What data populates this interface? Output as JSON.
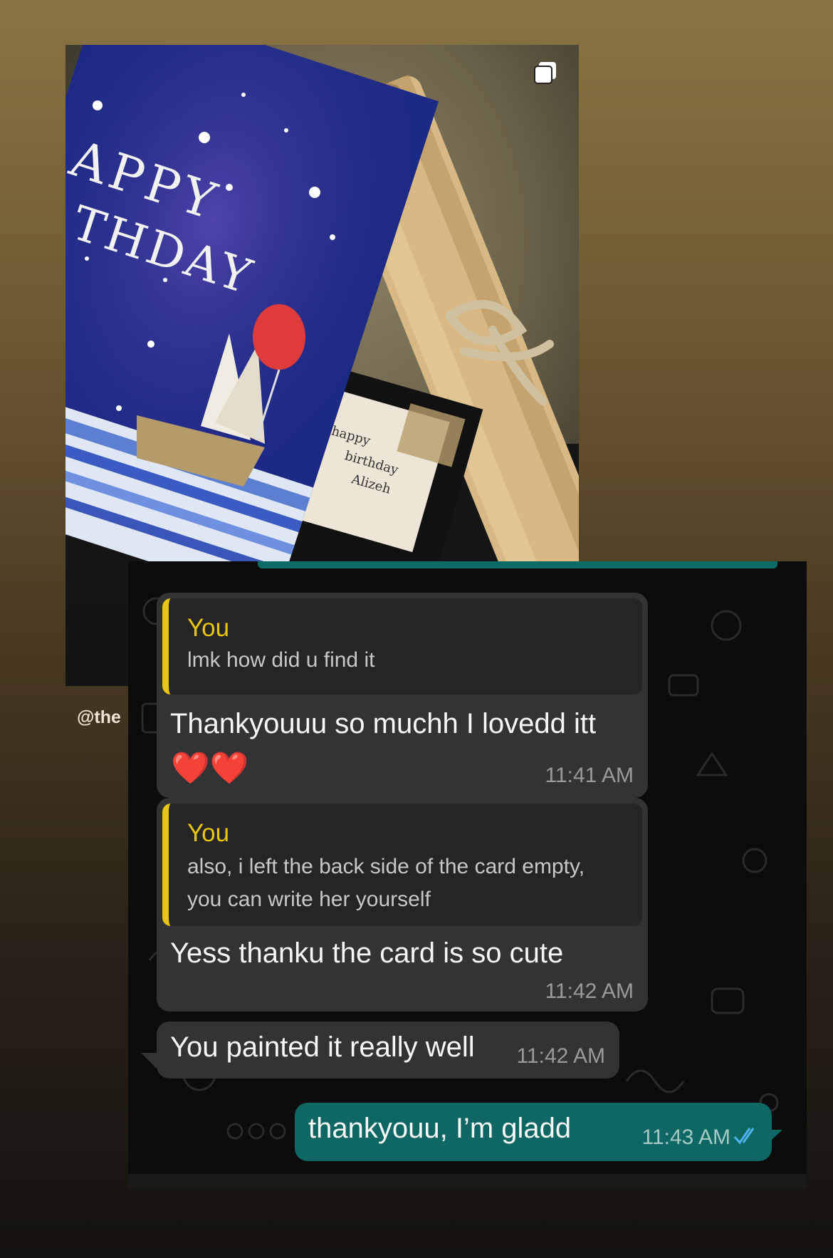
{
  "post": {
    "handle": "@the",
    "photo_icon": "multiple-photos-icon",
    "card_title_line1": "APPY",
    "card_title_line2": "THDAY",
    "note_line1": "happy",
    "note_line2": "birthday",
    "note_line3": "Alizeh"
  },
  "chat": {
    "messages": [
      {
        "quote_author": "You",
        "quote_text": [
          "lmk how did u find it"
        ],
        "text": "Thankyouuu so muchh I lovedd itt",
        "emoji": "❤️❤️",
        "time": "11:41 AM"
      },
      {
        "quote_author": "You",
        "quote_text": [
          "also, i left the back side of the card empty,",
          "you can write her yourself"
        ],
        "text": "Yess thanku the card is so cute",
        "time": "11:42 AM"
      },
      {
        "text": "You painted it really well",
        "time": "11:42 AM"
      },
      {
        "text": "thankyouu, I’m gladd",
        "time": "11:43 AM",
        "status_icon": "double-check-read-icon"
      }
    ]
  },
  "colors": {
    "quote_accent": "#e9c60d",
    "incoming_bubble": "#333336",
    "outgoing_bubble": "#0e6762",
    "read_ticks": "#4fb3f0"
  }
}
